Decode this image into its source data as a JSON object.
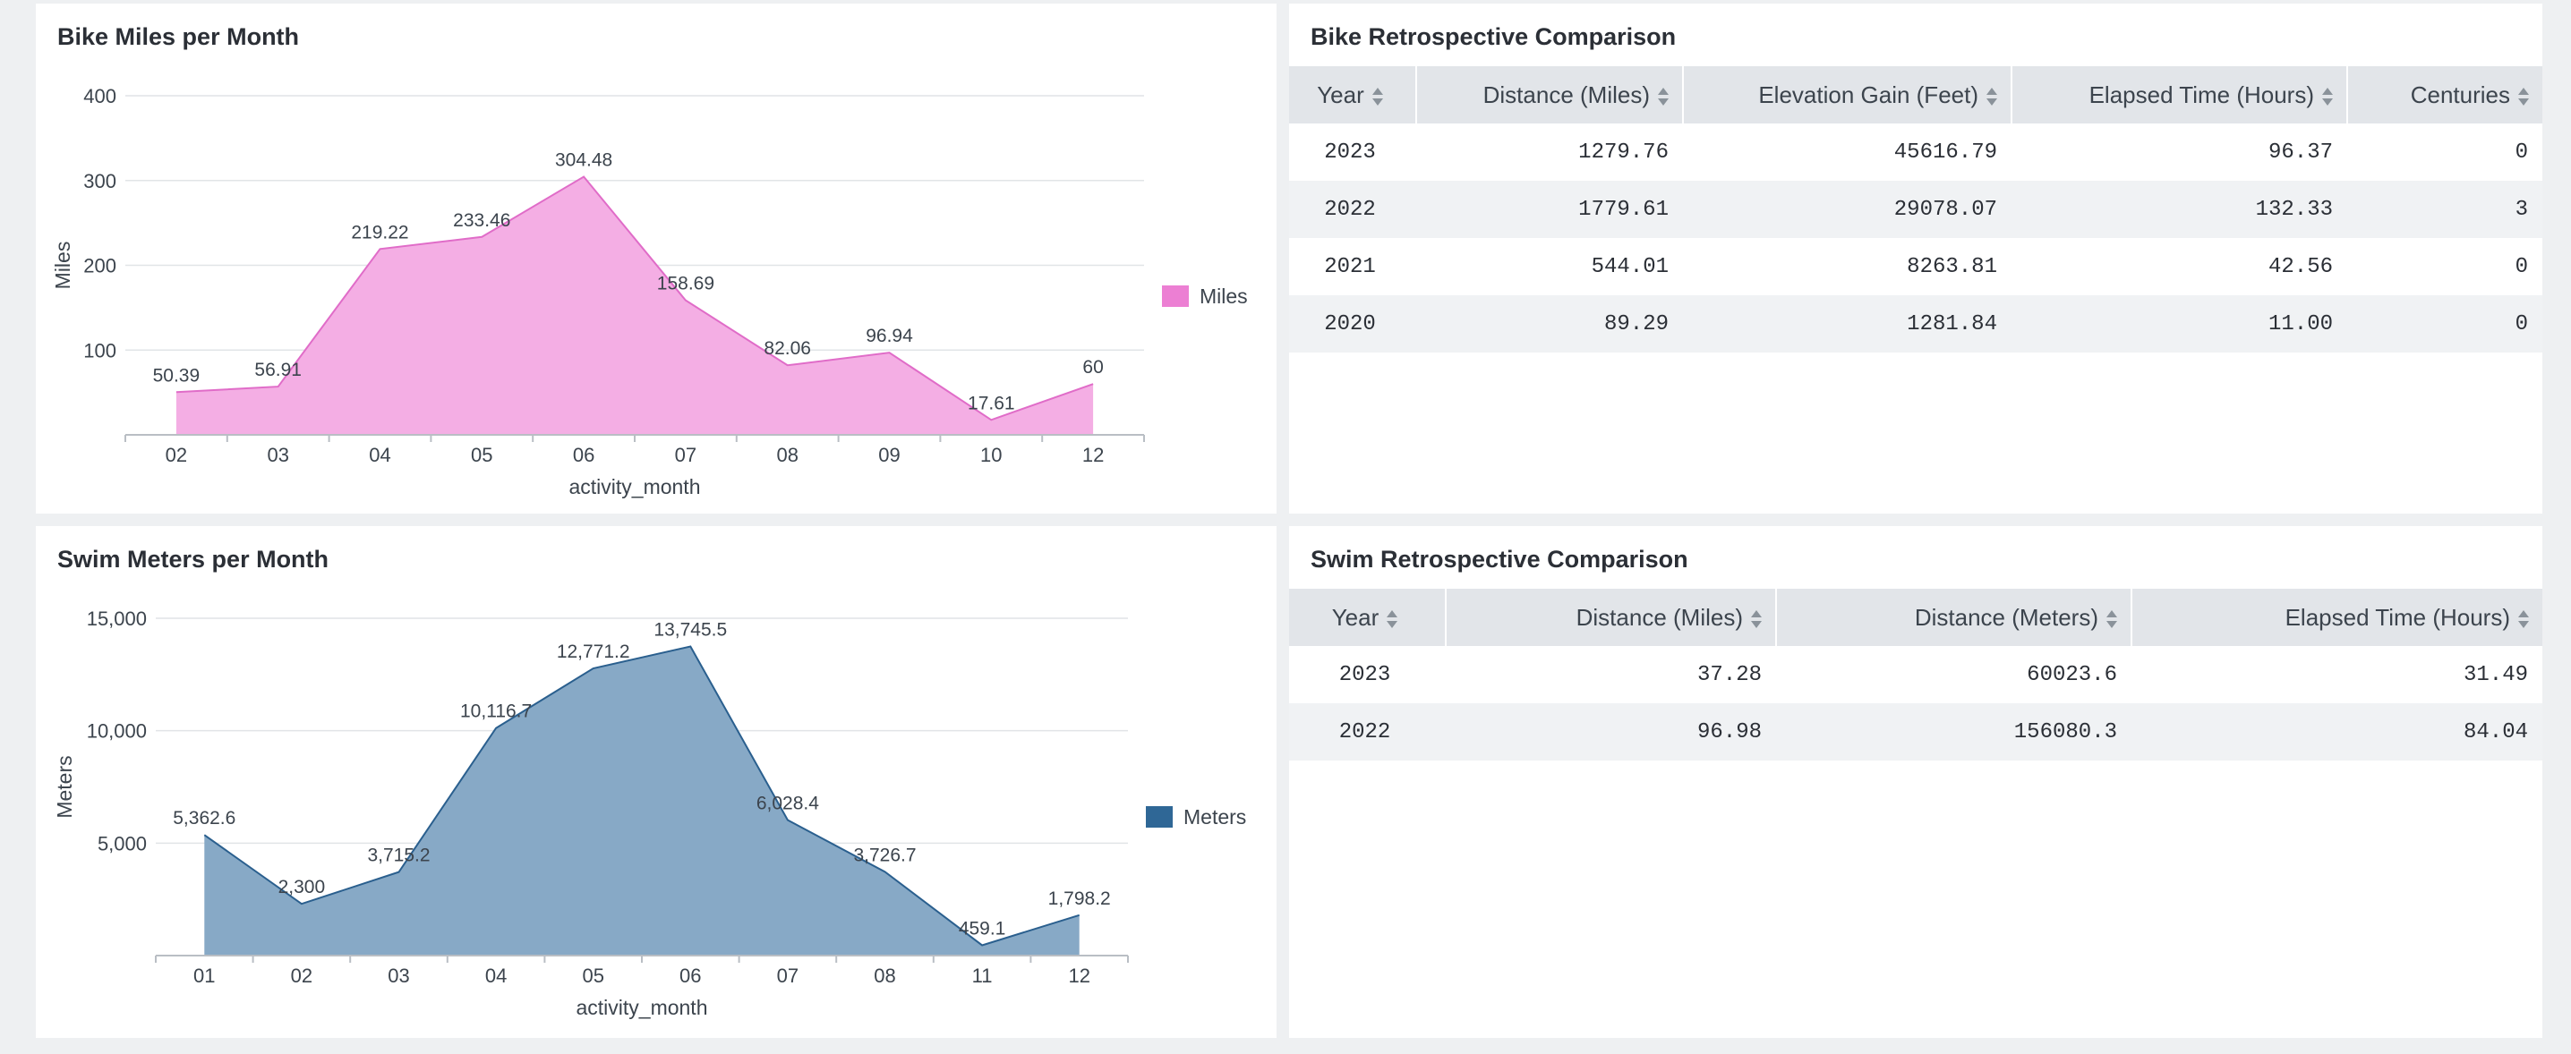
{
  "bike_chart": {
    "title": "Bike Miles per Month",
    "legend_label": "Miles",
    "legend_color": "#ec7fd3",
    "fill_color": "#f4aee4",
    "line_color": "#e06cc8"
  },
  "swim_chart": {
    "title": "Swim Meters per Month",
    "legend_label": "Meters",
    "legend_color": "#2f6796",
    "fill_color": "#87a9c6",
    "line_color": "#2a5f8e"
  },
  "bike_table": {
    "title": "Bike Retrospective Comparison",
    "columns": [
      "Year",
      "Distance (Miles)",
      "Elevation Gain (Feet)",
      "Elapsed Time (Hours)",
      "Centuries"
    ],
    "rows": [
      [
        "2023",
        "1279.76",
        "45616.79",
        "96.37",
        "0"
      ],
      [
        "2022",
        "1779.61",
        "29078.07",
        "132.33",
        "3"
      ],
      [
        "2021",
        "544.01",
        "8263.81",
        "42.56",
        "0"
      ],
      [
        "2020",
        "89.29",
        "1281.84",
        "11.00",
        "0"
      ]
    ]
  },
  "swim_table": {
    "title": "Swim Retrospective Comparison",
    "columns": [
      "Year",
      "Distance (Miles)",
      "Distance (Meters)",
      "Elapsed Time (Hours)"
    ],
    "rows": [
      [
        "2023",
        "37.28",
        "60023.6",
        "31.49"
      ],
      [
        "2022",
        "96.98",
        "156080.3",
        "84.04"
      ]
    ]
  },
  "chart_data": [
    {
      "type": "area",
      "title": "Bike Miles per Month",
      "xlabel": "activity_month",
      "ylabel": "Miles",
      "categories": [
        "02",
        "03",
        "04",
        "05",
        "06",
        "07",
        "08",
        "09",
        "10",
        "12"
      ],
      "series": [
        {
          "name": "Miles",
          "values": [
            50.39,
            56.91,
            219.22,
            233.46,
            304.48,
            158.69,
            82.06,
            96.94,
            17.61,
            60
          ]
        }
      ],
      "data_labels": [
        "50.39",
        "56.91",
        "219.22",
        "233.46",
        "304.48",
        "158.69",
        "82.06",
        "96.94",
        "17.61",
        "60"
      ],
      "yticks": [
        "100",
        "200",
        "300",
        "400"
      ],
      "ytick_values": [
        100,
        200,
        300,
        400
      ],
      "ylim": [
        0,
        400
      ],
      "legend": "right"
    },
    {
      "type": "area",
      "title": "Swim Meters per Month",
      "xlabel": "activity_month",
      "ylabel": "Meters",
      "categories": [
        "01",
        "02",
        "03",
        "04",
        "05",
        "06",
        "07",
        "08",
        "11",
        "12"
      ],
      "series": [
        {
          "name": "Meters",
          "values": [
            5362.6,
            2300,
            3715.2,
            10116.7,
            12771.2,
            13745.5,
            6028.4,
            3726.7,
            459.1,
            1798.2
          ]
        }
      ],
      "data_labels": [
        "5,362.6",
        "2,300",
        "3,715.2",
        "10,116.7",
        "12,771.2",
        "13,745.5",
        "6,028.4",
        "3,726.7",
        "459.1",
        "1,798.2"
      ],
      "yticks": [
        "5,000",
        "10,000",
        "15,000"
      ],
      "ytick_values": [
        5000,
        10000,
        15000
      ],
      "ylim": [
        0,
        15000
      ],
      "legend": "right"
    }
  ]
}
